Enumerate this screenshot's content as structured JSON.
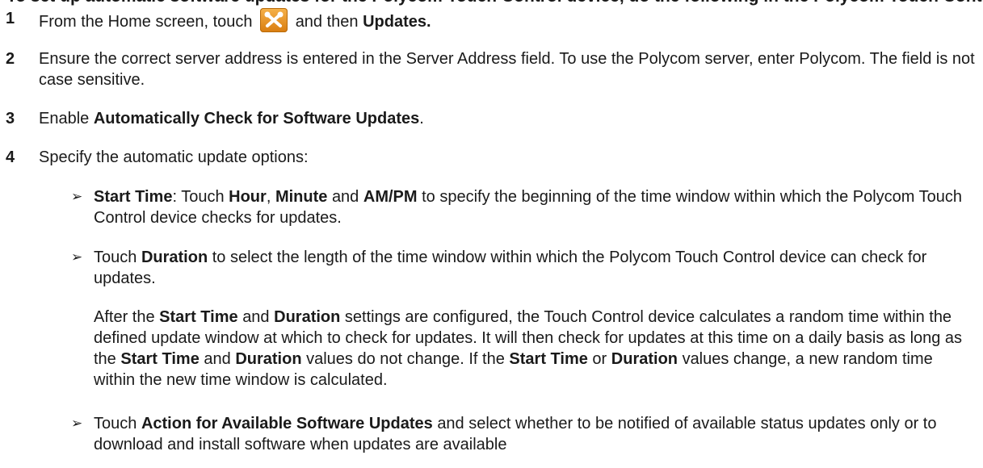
{
  "heading": "To set up automatic software updates for the Polycom Touch Control device, do the following in the Polycom Touch Control",
  "steps": [
    {
      "number": "1",
      "pre": "From the Home screen, touch",
      "icon": "tools-icon",
      "mid": "and then",
      "bold": "Updates."
    },
    {
      "number": "2",
      "text": "Ensure the correct server address is entered in the Server Address field. To use the Polycom server, enter Polycom. The field is not case sensitive."
    },
    {
      "number": "3",
      "pre": "Enable",
      "bold": "Automatically Check for Software Updates",
      "post": "."
    },
    {
      "number": "4",
      "text": "Specify the automatic update options:"
    }
  ],
  "bullets": [
    {
      "marker": "➢",
      "b1": "Start Time",
      "t1": ": Touch",
      "b2": "Hour",
      "t2": ",",
      "b3": "Minute",
      "t3": "and",
      "b4": "AM/PM",
      "t4": "to specify the beginning of the time window within which the Polycom Touch Control device checks for updates."
    },
    {
      "marker": "➢",
      "t1": "Touch",
      "b1": "Duration",
      "t2": "to select the length of the time window within which the Polycom Touch Control device can check for updates."
    },
    {
      "marker": "➢",
      "t1": "Touch",
      "b1": "Action for Available Software Updates",
      "t2": "and select whether to be notified of available status updates only or to download and install software when updates are available"
    }
  ],
  "paragraph": {
    "t1": "After the",
    "b1": "Start Time",
    "t2": "and",
    "b2": "Duration",
    "t3": "settings are configured, the Touch Control device calculates a random time within the defined update window at which to check for updates. It will then check for updates at this time on a daily basis as long as the",
    "b3": "Start Time",
    "t4": "and",
    "b4": "Duration",
    "t5": "values do not change. If the",
    "b5": "Start Time",
    "t6": "or",
    "b6": "Duration",
    "t7": "values change, a new random time within the new time window is calculated."
  }
}
